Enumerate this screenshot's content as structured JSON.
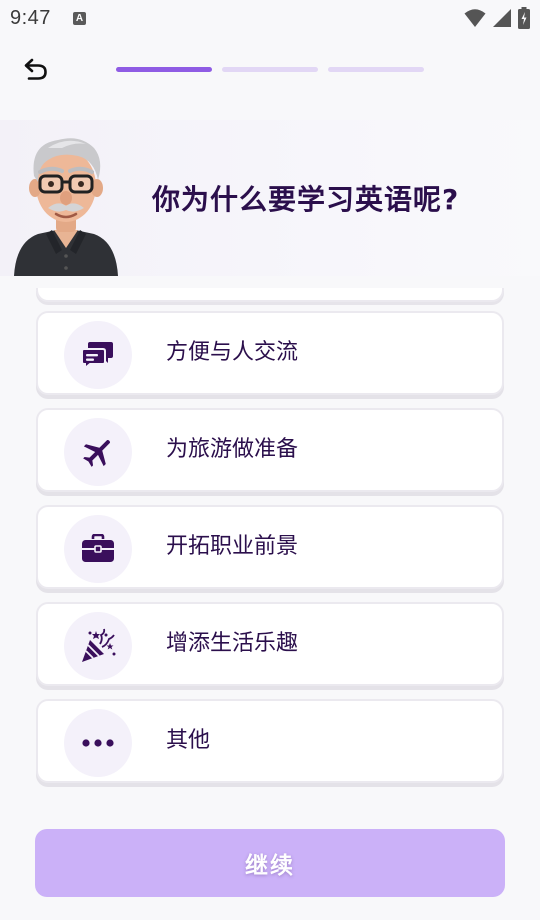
{
  "status_bar": {
    "time": "9:47",
    "badge": "A",
    "icons": [
      "wifi-icon",
      "cell-signal-icon",
      "battery-icon"
    ]
  },
  "nav": {
    "back_icon": "undo-arrow-icon",
    "progress_steps": 3,
    "progress_current": 1
  },
  "hero": {
    "question": "你为什么要学习英语呢?"
  },
  "options": [
    {
      "label": "方便与人交流",
      "icon": "chat-bubbles-icon"
    },
    {
      "label": "为旅游做准备",
      "icon": "airplane-icon"
    },
    {
      "label": "开拓职业前景",
      "icon": "briefcase-icon"
    },
    {
      "label": "增添生活乐趣",
      "icon": "party-popper-icon"
    },
    {
      "label": "其他",
      "icon": "more-dots-icon"
    }
  ],
  "continue_button": {
    "label": "继续"
  },
  "colors": {
    "accent": "#8f5ce4",
    "accent_light": "#e2d7f5",
    "text_dark": "#2b0f4c",
    "button_disabled": "#cbb1f8"
  }
}
